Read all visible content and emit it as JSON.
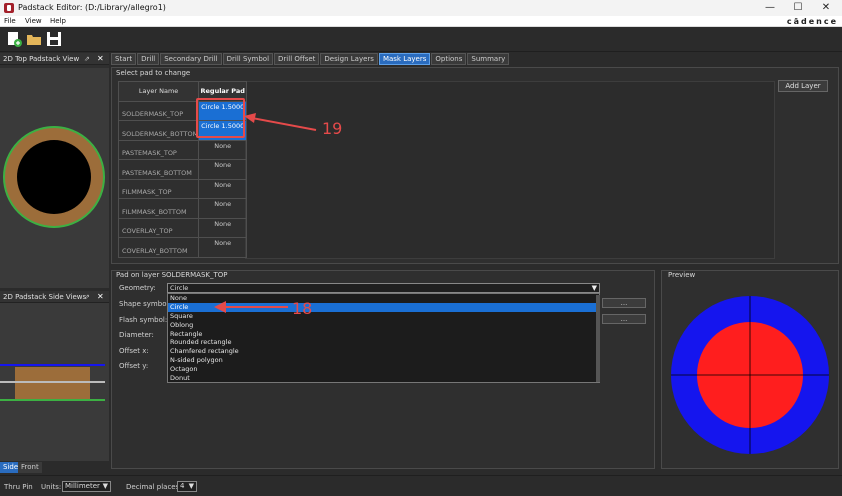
{
  "window": {
    "title": "Padstack Editor:  (D:/Library/allegro1)",
    "minimize": "—",
    "maximize": "☐",
    "close": "✕"
  },
  "menu": [
    "File",
    "View",
    "Help"
  ],
  "brand": "cādence",
  "panels": {
    "top_view_title": "2D Top Padstack View",
    "side_view_title": "2D Padstack Side Views",
    "pin_glyph": "⇗",
    "close_glyph": "✕",
    "side_tabs": [
      "Side",
      "Front"
    ]
  },
  "tabs": [
    "Start",
    "Drill",
    "Secondary Drill",
    "Drill Symbol",
    "Drill Offset",
    "Design Layers",
    "Mask Layers",
    "Options",
    "Summary"
  ],
  "active_tab": "Mask Layers",
  "select_pad": {
    "group_title": "Select pad to change",
    "col_layer": "Layer Name",
    "col_pad": "Regular Pad",
    "add_layer_label": "Add Layer",
    "rows": [
      {
        "layer": "SOLDERMASK_TOP",
        "pad": "Circle 1.5000",
        "selected": true
      },
      {
        "layer": "SOLDERMASK_BOTTOM",
        "pad": "Circle 1.5000",
        "selected": true
      },
      {
        "layer": "PASTEMASK_TOP",
        "pad": "None",
        "selected": false
      },
      {
        "layer": "PASTEMASK_BOTTOM",
        "pad": "None",
        "selected": false
      },
      {
        "layer": "FILMMASK_TOP",
        "pad": "None",
        "selected": false
      },
      {
        "layer": "FILMMASK_BOTTOM",
        "pad": "None",
        "selected": false
      },
      {
        "layer": "COVERLAY_TOP",
        "pad": "None",
        "selected": false
      },
      {
        "layer": "COVERLAY_BOTTOM",
        "pad": "None",
        "selected": false
      }
    ]
  },
  "pad_on_layer": {
    "group_title": "Pad on layer SOLDERMASK_TOP",
    "geometry_label": "Geometry:",
    "geometry_value": "Circle",
    "shape_symbol_label": "Shape symbol:",
    "flash_symbol_label": "Flash symbol:",
    "diameter_label": "Diameter:",
    "offset_x_label": "Offset x:",
    "offset_y_label": "Offset y:",
    "browse_label": "...",
    "geometry_options": [
      "None",
      "Circle",
      "Square",
      "Oblong",
      "Rectangle",
      "Rounded rectangle",
      "Chamfered rectangle",
      "N-sided polygon",
      "Octagon",
      "Donut"
    ],
    "selected_option": "Circle"
  },
  "preview": {
    "title": "Preview",
    "outer_color": "#1515ee",
    "inner_color": "#ff1e1e"
  },
  "annotations": {
    "label_19": "19",
    "label_18": "18",
    "color": "#e54a4a"
  },
  "top_view_colors": {
    "ring": "#9c6d3a",
    "ring_edge": "#3cb043",
    "hole": "#000000"
  },
  "statusbar": {
    "type": "Thru Pin",
    "units_label": "Units:",
    "units_value": "Millimeter",
    "decimal_label": "Decimal places:",
    "decimal_value": "4"
  }
}
